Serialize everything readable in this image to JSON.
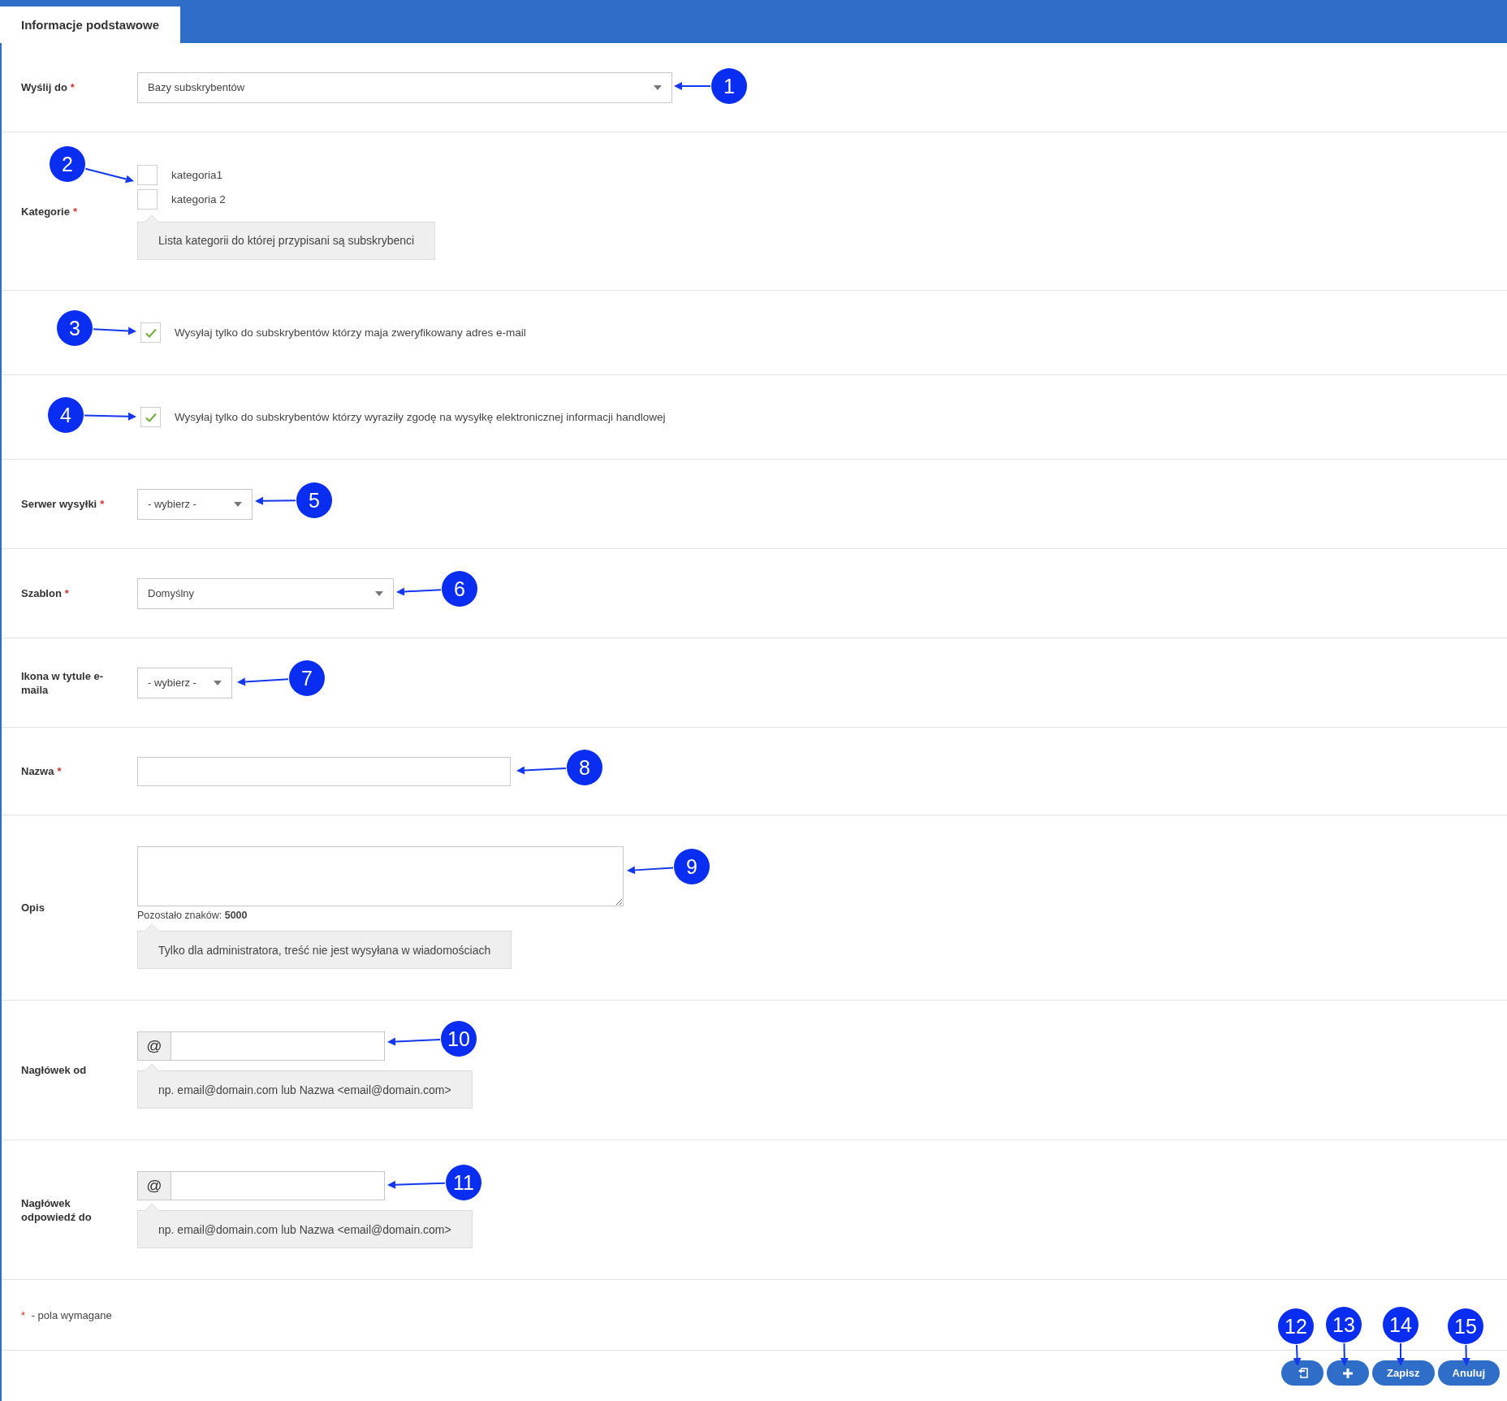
{
  "tabs": [
    {
      "label": "Informacje podstawowe",
      "selected": true
    }
  ],
  "form": {
    "required_mark": "*",
    "rows": [
      {
        "kind": "select",
        "label": "Wyślij do",
        "required": true,
        "value": "Bazy subskrybentów"
      },
      {
        "kind": "checklist",
        "label": "Kategorie",
        "required": true,
        "options": [
          {
            "label": "kategoria1",
            "checked": false
          },
          {
            "label": "kategoria 2",
            "checked": false
          }
        ],
        "hint": "Lista kategorii do której przypisani są subskrybenci"
      },
      {
        "kind": "checkbox",
        "text": "Wysyłaj tylko do subskrybentów którzy maja zweryfikowany adres e-mail",
        "checked": true
      },
      {
        "kind": "checkbox",
        "text": "Wysyłaj tylko do subskrybentów którzy wyraziły zgodę na wysyłkę elektronicznej informacji handlowej",
        "checked": true
      },
      {
        "kind": "select",
        "label": "Serwer wysyłki",
        "required": true,
        "value": "- wybierz -"
      },
      {
        "kind": "select",
        "label": "Szablon",
        "required": true,
        "value": "Domyślny"
      },
      {
        "kind": "select",
        "label": "Ikona w tytule e-maila",
        "required": false,
        "value": "- wybierz -"
      },
      {
        "kind": "text",
        "label": "Nazwa",
        "required": true
      },
      {
        "kind": "textarea",
        "label": "Opis",
        "required": false,
        "counter": "Pozostało znaków: **5000**",
        "hint": "Tylko dla administratora, treść nie jest wysyłana w wiadomościach"
      },
      {
        "kind": "email",
        "label": "Nagłówek od",
        "required": false,
        "addon": "@",
        "hint": "np. email@domain.com lub Nazwa <email@domain.com>"
      },
      {
        "kind": "email",
        "label": "Nagłówek odpowiedź do",
        "required": false,
        "addon": "@",
        "hint": "np. email@domain.com lub Nazwa <email@domain.com>"
      }
    ],
    "required_note": "- pola wymagane"
  },
  "buttons": [
    {
      "kind": "icon"
    },
    {
      "kind": "icon"
    },
    {
      "kind": "text",
      "label": "Zapisz"
    },
    {
      "kind": "text",
      "label": "Anuluj"
    }
  ],
  "callouts": [
    {
      "number": "1"
    },
    {
      "number": "2"
    },
    {
      "number": "3"
    },
    {
      "number": "4"
    },
    {
      "number": "5"
    },
    {
      "number": "6"
    },
    {
      "number": "7"
    },
    {
      "number": "8"
    },
    {
      "number": "9"
    },
    {
      "number": "10"
    },
    {
      "number": "11"
    },
    {
      "number": "12"
    },
    {
      "number": "13"
    },
    {
      "number": "14"
    },
    {
      "number": "15"
    }
  ]
}
